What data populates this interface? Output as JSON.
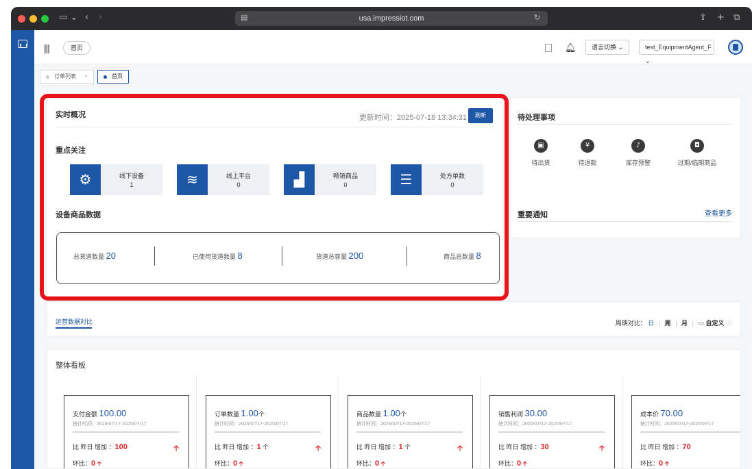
{
  "browser": {
    "url": "usa.impressiot.com"
  },
  "topbar": {
    "home_pill": "首页",
    "lang_switch": "语言切换 ⌄",
    "user_name": "test_EquipmentAgent_F ⌄"
  },
  "tabs": [
    {
      "label": "订单列表",
      "close": "×"
    },
    {
      "label": "首页"
    }
  ],
  "realtime": {
    "title": "实时概况",
    "update_label": "更新时间：2025-07-18 13:34:31",
    "refresh_label": "刷新",
    "focus_title": "重点关注",
    "focus_items": [
      {
        "label": "线下设备",
        "value": "1",
        "icon": "gear-icon"
      },
      {
        "label": "线上平台",
        "value": "0",
        "icon": "layers-icon"
      },
      {
        "label": "畅销商品",
        "value": "0",
        "icon": "bar-chart-icon"
      },
      {
        "label": "处方单数",
        "value": "0",
        "icon": "list-icon"
      }
    ],
    "device_title": "设备商品数据",
    "stats": [
      {
        "label": "总货道数量",
        "value": "20"
      },
      {
        "label": "已使用货道数量",
        "value": "8"
      },
      {
        "label": "货道总容量",
        "value": "200"
      },
      {
        "label": "商品总数量",
        "value": "8"
      }
    ]
  },
  "pending": {
    "title": "待处理事项",
    "items": [
      {
        "label": "待出货",
        "icon": "shipment-icon"
      },
      {
        "label": "待退款",
        "icon": "refund-icon"
      },
      {
        "label": "库存预警",
        "icon": "bell-alert-icon"
      },
      {
        "label": "过期/临期商品",
        "icon": "expired-goods-icon"
      }
    ],
    "notice_title": "重要通知",
    "see_more": "查看更多"
  },
  "ops": {
    "tab_label": "运营数据对比",
    "period_label": "周期对比：",
    "periods": [
      "日",
      "周",
      "月",
      "自定义"
    ]
  },
  "dashboard": {
    "title": "整体看板",
    "cards": [
      {
        "name": "支付金额",
        "value": "100.00",
        "unit": "",
        "period": "统计时间：2025/07/17-2025/07/17",
        "cmp_label": "比 昨日 增加 ：",
        "cmp_value": "100",
        "cmp_unit": "",
        "hb_label": "环比：",
        "hb_value": "0"
      },
      {
        "name": "订单数量",
        "value": "1.00",
        "unit": "个",
        "period": "统计时间：2025/07/17-2025/07/17",
        "cmp_label": "比 昨日 增加 ：",
        "cmp_value": "1",
        "cmp_unit": " 个",
        "hb_label": "环比：",
        "hb_value": "0"
      },
      {
        "name": "商品数量",
        "value": "1.00",
        "unit": "个",
        "period": "统计时间：2025/07/17-2025/07/17",
        "cmp_label": "比 昨日 增加 ：",
        "cmp_value": "1",
        "cmp_unit": " 个",
        "hb_label": "环比：",
        "hb_value": "0"
      },
      {
        "name": "销售利润",
        "value": "30.00",
        "unit": "",
        "period": "统计时间：2025/07/17-2025/07/17",
        "cmp_label": "比 昨日 增加 ：",
        "cmp_value": "30",
        "cmp_unit": "",
        "hb_label": "环比：",
        "hb_value": "0"
      },
      {
        "name": "成本价",
        "value": "70.00",
        "unit": "",
        "period": "统计时间：2025/07/17-2025/07/17",
        "cmp_label": "比 昨日 增加 ：",
        "cmp_value": "70",
        "cmp_unit": "",
        "hb_label": "环比：",
        "hb_value": "0"
      }
    ]
  },
  "colors": {
    "primary": "#1e57a6",
    "highlight": "#e8141b",
    "increase": "#d9242a"
  }
}
